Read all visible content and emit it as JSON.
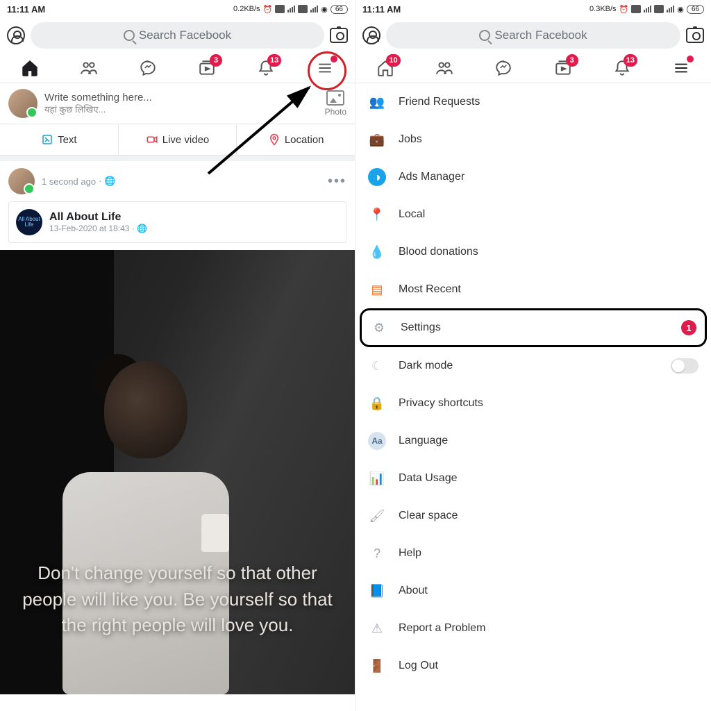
{
  "status": {
    "time": "11:11 AM",
    "left_speed": "0.2KB/s",
    "right_speed": "0.3KB/s",
    "battery": "66"
  },
  "search": {
    "placeholder": "Search Facebook"
  },
  "left_tabs": {
    "videos_badge": "3",
    "notif_badge": "13"
  },
  "right_tabs": {
    "home_badge": "10",
    "videos_badge": "3",
    "notif_badge": "13"
  },
  "composer": {
    "placeholder": "Write something here...",
    "placeholder_hi": "यहां कुछ लिखिए...",
    "photo_label": "Photo",
    "text_label": "Text",
    "live_label": "Live video",
    "location_label": "Location"
  },
  "post": {
    "time": "1 second ago",
    "page_avatar_text": "All About Life",
    "page_name": "All About Life",
    "page_sub": "13-Feb-2020 at 18:43",
    "quote": "Don't change yourself so that other people will like you. Be yourself so that the right people will love you."
  },
  "menu": {
    "items": [
      {
        "label": "Friend Requests",
        "icon": "👥",
        "color": "#1877f2"
      },
      {
        "label": "Jobs",
        "icon": "💼",
        "color": "#a06a3a"
      },
      {
        "label": "Ads Manager",
        "icon": "◑",
        "color": "#1aa3e8"
      },
      {
        "label": "Local",
        "icon": "📍",
        "color": "#f0284a"
      },
      {
        "label": "Blood donations",
        "icon": "💧",
        "color": "#e02444"
      },
      {
        "label": "Most Recent",
        "icon": "▤",
        "color": "#f56b1f"
      },
      {
        "label": "Settings",
        "icon": "⚙",
        "color": "#a0a4aa",
        "highlight": true,
        "badge": "1"
      },
      {
        "label": "Dark mode",
        "icon": "☾",
        "color": "#c8ccd0",
        "toggle": true
      },
      {
        "label": "Privacy shortcuts",
        "icon": "🔒",
        "color": "#a0a4aa"
      },
      {
        "label": "Language",
        "icon": "Aa",
        "color": "#8aaed4"
      },
      {
        "label": "Data Usage",
        "icon": "📊",
        "color": "#8aaed4"
      },
      {
        "label": "Clear space",
        "icon": "🖌",
        "color": "#a0a4aa"
      },
      {
        "label": "Help",
        "icon": "?",
        "color": "#a0a4aa"
      },
      {
        "label": "About",
        "icon": "📘",
        "color": "#6b7580"
      },
      {
        "label": "Report a Problem",
        "icon": "⚠",
        "color": "#a0a4aa"
      },
      {
        "label": "Log Out",
        "icon": "🚪",
        "color": "#a0a4aa"
      }
    ]
  }
}
